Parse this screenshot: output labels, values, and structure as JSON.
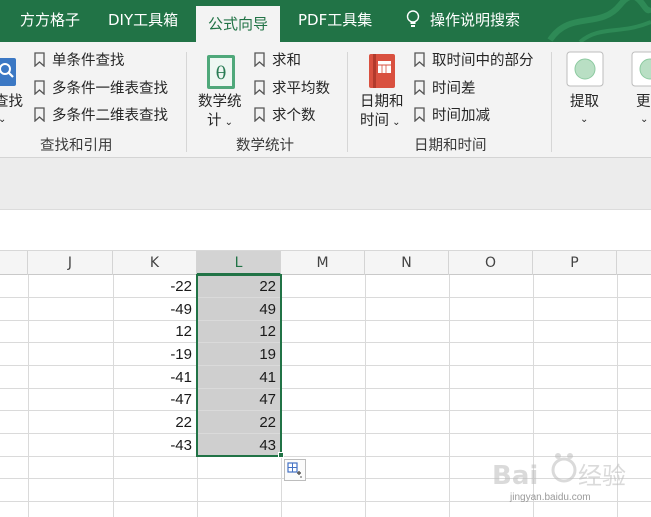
{
  "tabs": [
    {
      "label": "方方格子"
    },
    {
      "label": "DIY工具箱"
    },
    {
      "label": "公式向导"
    },
    {
      "label": "PDF工具集"
    },
    {
      "label": "操作说明搜索"
    }
  ],
  "ribbon": {
    "lookup": {
      "big_label": "查找",
      "items": [
        "单条件查找",
        "多条件一维表查找",
        "多条件二维表查找"
      ],
      "group_label": "查找和引用"
    },
    "math": {
      "big_label_line1": "数学统",
      "big_label_line2": "计",
      "items": [
        "求和",
        "求平均数",
        "求个数"
      ],
      "group_label": "数学统计"
    },
    "datetime": {
      "big_label_line1": "日期和",
      "big_label_line2": "时间",
      "items": [
        "取时间中的部分",
        "时间差",
        "时间加减"
      ],
      "group_label": "日期和时间"
    },
    "extract": {
      "label": "提取"
    },
    "more": {
      "label": "更"
    }
  },
  "sheet": {
    "columns": [
      "J",
      "K",
      "L",
      "M",
      "N",
      "O",
      "P"
    ],
    "selected_column": "L",
    "col_k": [
      "-22",
      "-49",
      "12",
      "-19",
      "-41",
      "-47",
      "22",
      "-43"
    ],
    "col_l": [
      "22",
      "49",
      "12",
      "19",
      "41",
      "47",
      "22",
      "43"
    ]
  },
  "watermark": {
    "text": "jingyan.baidu.com"
  }
}
